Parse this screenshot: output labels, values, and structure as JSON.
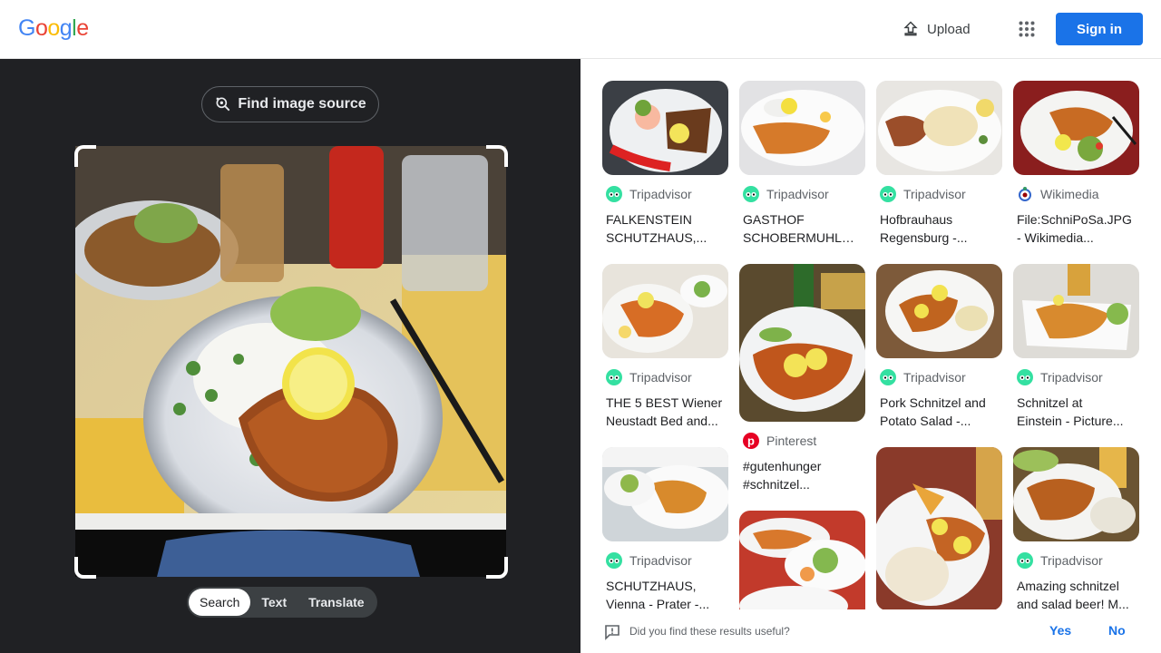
{
  "header": {
    "logo": [
      "G",
      "o",
      "o",
      "g",
      "l",
      "e"
    ],
    "logo_colors": [
      "#4285f4",
      "#ea4335",
      "#fbbc05",
      "#4285f4",
      "#34a853",
      "#ea4335"
    ],
    "upload_label": "Upload",
    "signin_label": "Sign in"
  },
  "lens": {
    "find_source_label": "Find image source",
    "tabs": [
      "Search",
      "Text",
      "Translate"
    ],
    "active_tab": "Search"
  },
  "results": {
    "col1": [
      {
        "source": "Tripadvisor",
        "source_icon": "tripadvisor-icon",
        "title": [
          "FALKENSTEIN",
          "SCHUTZHAUS,..."
        ]
      },
      {
        "source": "Tripadvisor",
        "source_icon": "tripadvisor-icon",
        "title": [
          "THE 5 BEST Wiener",
          "Neustadt Bed and..."
        ]
      },
      {
        "source": "Tripadvisor",
        "source_icon": "tripadvisor-icon",
        "title": [
          "SCHUTZHAUS,",
          "Vienna - Prater -..."
        ]
      }
    ],
    "col2": [
      {
        "source": "Tripadvisor",
        "source_icon": "tripadvisor-icon",
        "title": [
          "GASTHOF",
          "SCHOBERMUHLE,..."
        ]
      },
      {
        "source": "Pinterest",
        "source_icon": "pinterest-icon",
        "title": [
          "#gutenhunger",
          "#schnitzel..."
        ]
      }
    ],
    "col3": [
      {
        "source": "Tripadvisor",
        "source_icon": "tripadvisor-icon",
        "title": [
          "Hofbrauhaus",
          "Regensburg -..."
        ]
      },
      {
        "source": "Tripadvisor",
        "source_icon": "tripadvisor-icon",
        "title": [
          "Pork Schnitzel and",
          "Potato Salad -..."
        ]
      }
    ],
    "col4": [
      {
        "source": "Wikimedia",
        "source_icon": "wikimedia-icon",
        "title": [
          "File:SchniPoSa.JPG",
          "- Wikimedia..."
        ]
      },
      {
        "source": "Tripadvisor",
        "source_icon": "tripadvisor-icon",
        "title": [
          "Schnitzel at",
          "Einstein - Picture..."
        ]
      },
      {
        "source": "Tripadvisor",
        "source_icon": "tripadvisor-icon",
        "title": [
          "Amazing schnitzel",
          "and salad beer! M..."
        ]
      }
    ]
  },
  "feedback": {
    "question": "Did you find these results useful?",
    "yes_label": "Yes",
    "no_label": "No"
  },
  "colors": {
    "accent": "#1a73e8",
    "dark_panel": "#202124",
    "tripadvisor": "#34e0a1",
    "pinterest": "#e60023"
  }
}
